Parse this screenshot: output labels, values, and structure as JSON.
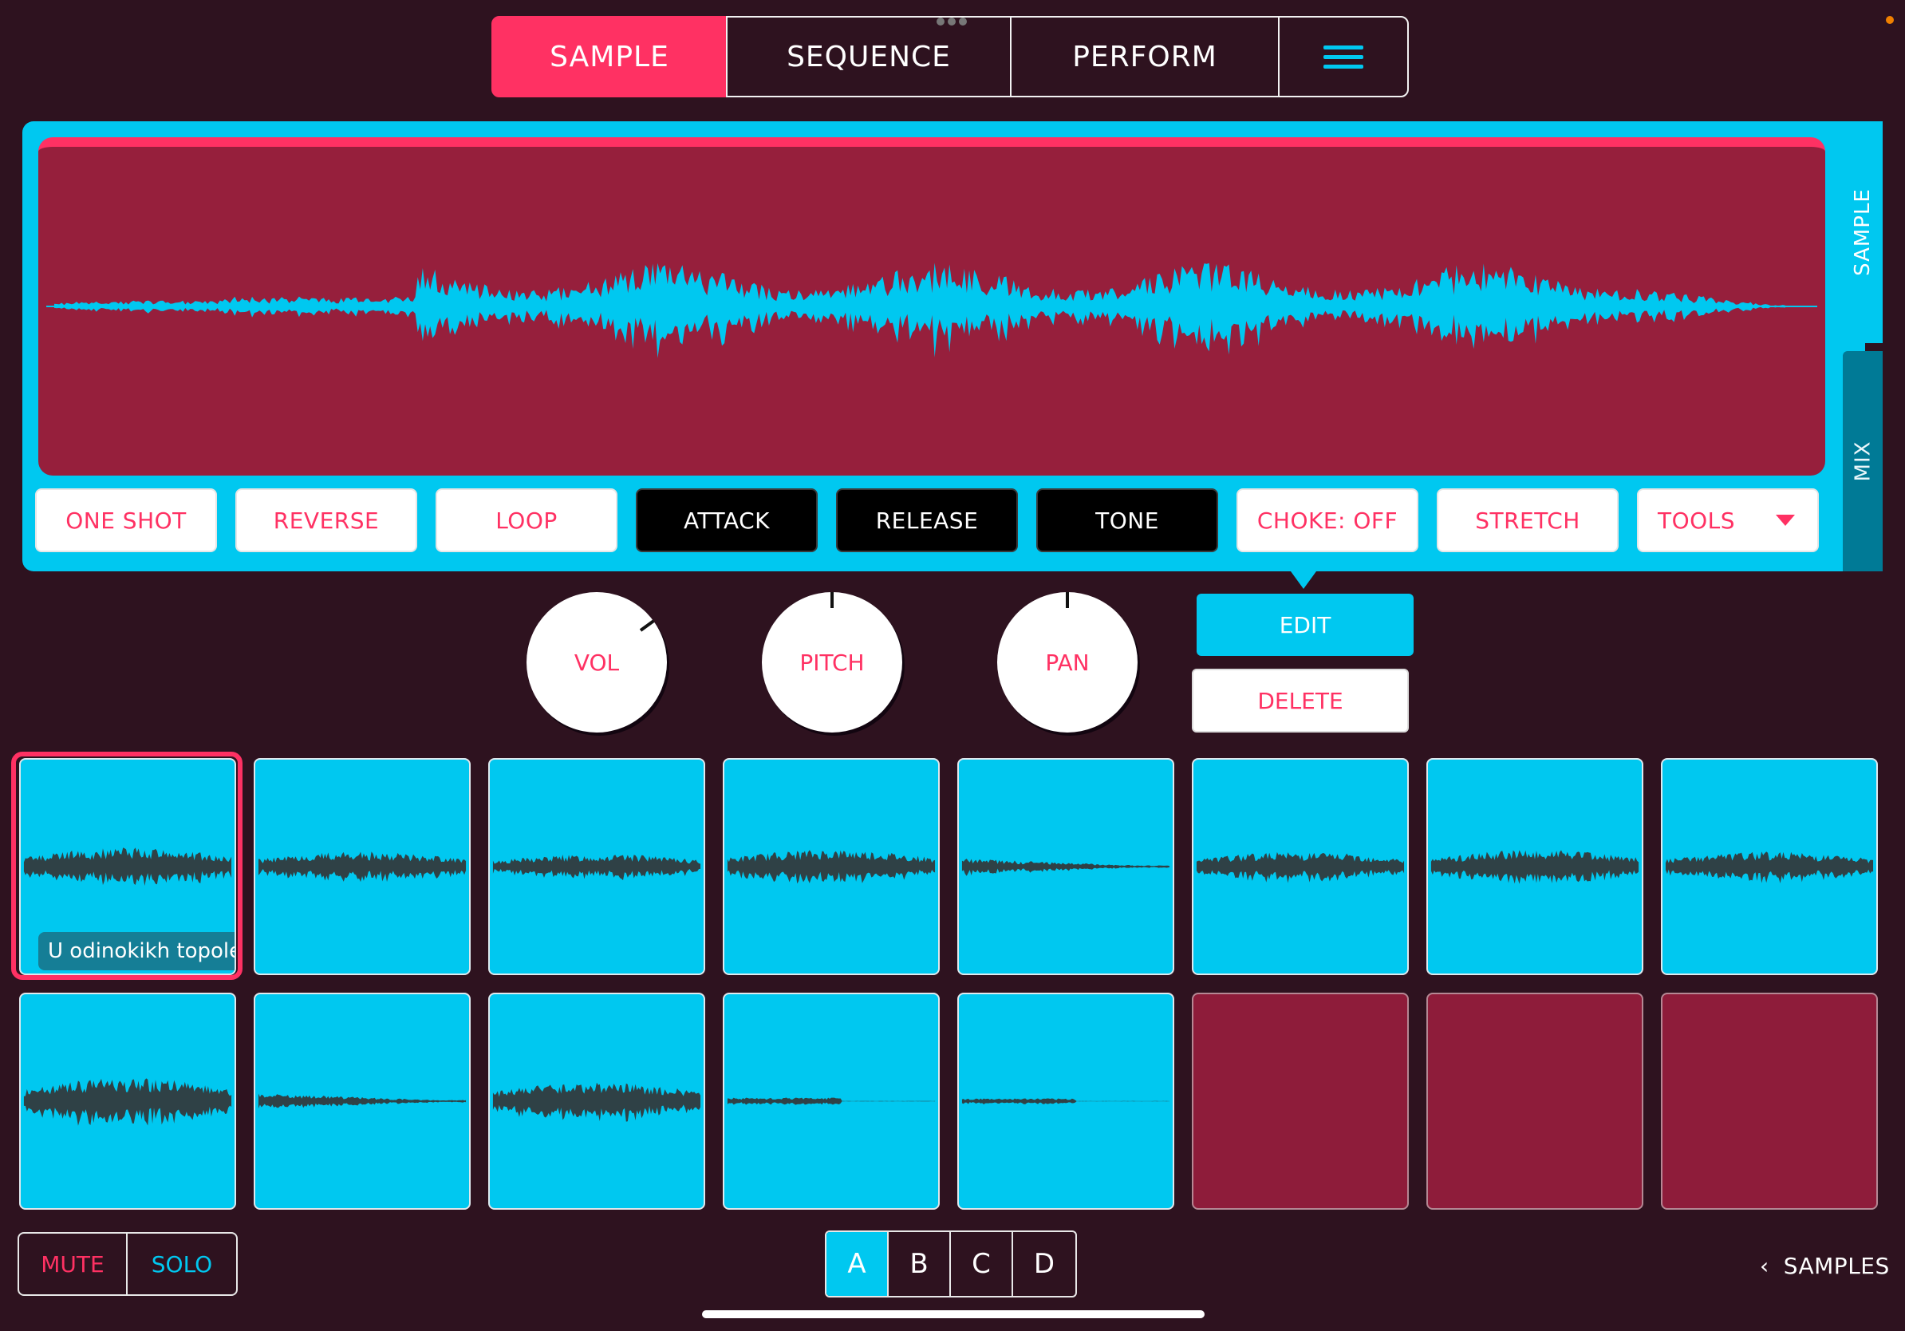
{
  "top_tabs": {
    "sample": "SAMPLE",
    "sequence": "SEQUENCE",
    "perform": "PERFORM"
  },
  "side_tabs": {
    "sample": "SAMPLE",
    "mix": "MIX"
  },
  "controls": {
    "one_shot": "ONE SHOT",
    "reverse": "REVERSE",
    "loop": "LOOP",
    "attack": "ATTACK",
    "release": "RELEASE",
    "tone": "TONE",
    "choke": "CHOKE: OFF",
    "stretch": "STRETCH",
    "tools": "TOOLS"
  },
  "knobs": {
    "vol": "VOL",
    "pitch": "PITCH",
    "pan": "PAN"
  },
  "knob_levels": {
    "vol": 0.7,
    "pitch": 0.5,
    "pan": 0.5
  },
  "actions": {
    "edit": "EDIT",
    "delete": "DELETE"
  },
  "pads": {
    "selected_label": "U odinokikh topoley",
    "loaded_count": 13,
    "empty_count": 3
  },
  "bottom": {
    "mute": "MUTE",
    "solo": "SOLO",
    "banks": [
      "A",
      "B",
      "C",
      "D"
    ],
    "active_bank": "A",
    "samples_link": "SAMPLES"
  },
  "colors": {
    "background": "#2e121f",
    "accent_pink": "#ff3163",
    "accent_cyan": "#00c8f0",
    "wave_bg": "#961f3c",
    "pad_wave": "#2f4146"
  },
  "icons": {
    "menu": "hamburger-icon",
    "tools_dropdown": "caret-down-icon",
    "samples_back": "chevron-left-icon"
  }
}
